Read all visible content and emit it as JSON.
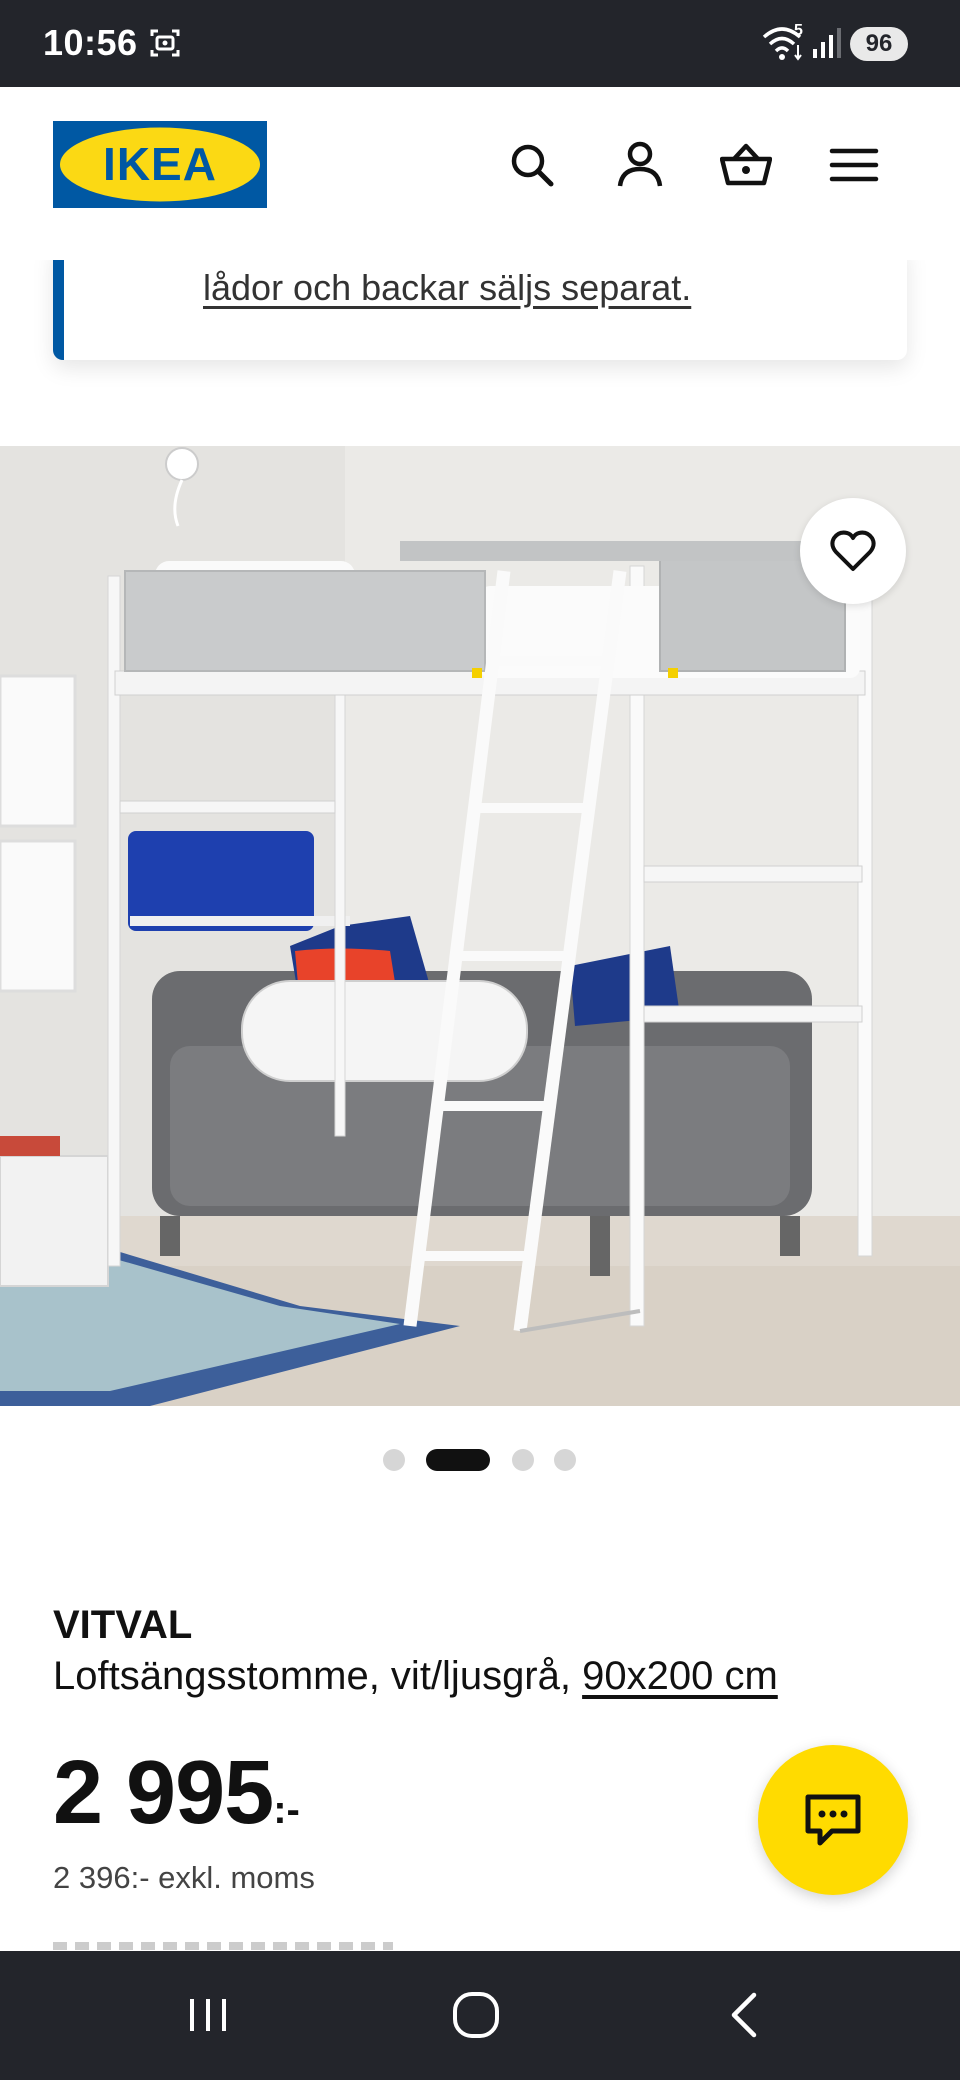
{
  "status_bar": {
    "time": "10:56",
    "wifi_badge": "5",
    "battery": "96",
    "icons": [
      "screen-recorder-icon",
      "wifi-icon",
      "signal-icon"
    ]
  },
  "header": {
    "logo_text": "IKEA",
    "logo_colors": {
      "background": "#0058a3",
      "oval": "#fbd914"
    },
    "icons": [
      "search-icon",
      "account-icon",
      "cart-icon",
      "menu-icon"
    ]
  },
  "notice": {
    "text": "lådor och backar säljs separat.",
    "accent_color": "#0058a3"
  },
  "gallery": {
    "favorite_icon": "heart-outline-icon",
    "dot_count": 4,
    "active_dot": 2
  },
  "product": {
    "brand": "VITVAL",
    "description": "Loftsängsstomme, vit/ljusgrå, ",
    "size": "90x200 cm",
    "price": "2 995",
    "price_suffix": ":-",
    "price_ex_vat": "2 396:- exkl. moms"
  },
  "chat": {
    "icon": "chat-bubble-icon",
    "color": "#ffdb00"
  },
  "nav_bar": {
    "icons": [
      "recents-icon",
      "home-icon",
      "back-icon"
    ]
  }
}
